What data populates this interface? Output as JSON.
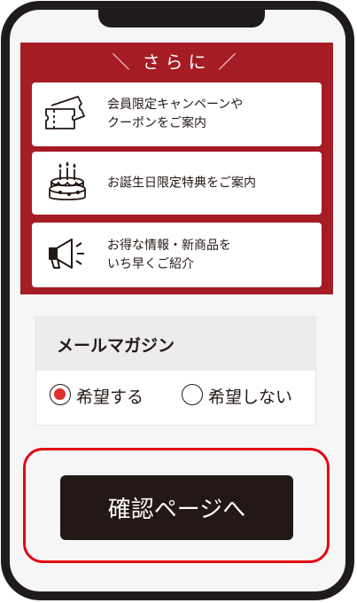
{
  "promo": {
    "heading": "さらに",
    "cards": [
      {
        "icon": "ticket-coupon-icon",
        "text": "会員限定キャンペーンや\nクーポンをご案内"
      },
      {
        "icon": "birthday-cake-icon",
        "text": "お誕生日限定特典をご案内"
      },
      {
        "icon": "megaphone-icon",
        "text": "お得な情報・新商品を\nいち早くご紹介"
      }
    ]
  },
  "newsletter": {
    "title": "メールマガジン",
    "options": [
      {
        "label": "希望する",
        "selected": true
      },
      {
        "label": "希望しない",
        "selected": false
      }
    ]
  },
  "cta": {
    "label": "確認ページへ"
  },
  "colors": {
    "promo_bg": "#a51c24",
    "cta_bg": "#231815",
    "highlight_ring": "#e30613",
    "radio_dot": "#e02f2f"
  }
}
